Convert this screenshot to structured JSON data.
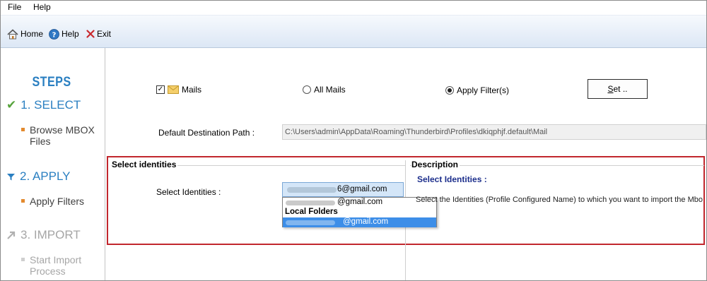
{
  "menu": {
    "file": "File",
    "help": "Help"
  },
  "toolbar": {
    "home": "Home",
    "help": "Help",
    "exit": "Exit"
  },
  "sidebar": {
    "title": "STEPS",
    "steps": [
      {
        "label": "1. SELECT",
        "sub": "Browse MBOX Files"
      },
      {
        "label": "2. APPLY",
        "sub": "Apply Filters"
      },
      {
        "label": "3. IMPORT",
        "sub": "Start Import Process"
      }
    ]
  },
  "main": {
    "mails_label": "Mails",
    "mails_checked": true,
    "all_mails_label": "All Mails",
    "apply_filters_label": "Apply Filter(s)",
    "selected_option": "apply_filters",
    "set_button": {
      "mnemonic": "S",
      "rest": "et .."
    },
    "destination_label": "Default Destination Path :",
    "destination_value": "C:\\Users\\admin\\AppData\\Roaming\\Thunderbird\\Profiles\\dkiqphjf.default\\Mail"
  },
  "identities": {
    "group_title": "Select identities",
    "field_label": "Select Identities :",
    "selected_value": "6@gmail.com",
    "options": [
      "@gmail.com",
      "Local Folders",
      "@gmail.com"
    ],
    "selected_index": 2
  },
  "description": {
    "group_title": "Description",
    "heading": "Select Identities :",
    "text": "Select the Identities (Profile Configured Name) to  which  you want to import the Mbo"
  },
  "colors": {
    "accent": "#2a7fc1",
    "check": "#57a33c",
    "bullet": "#e38a2e",
    "highlight_box": "#c1272d",
    "selection": "#3d8ee8",
    "desc_heading": "#1d2f8c"
  },
  "icons": [
    "home-icon",
    "help-icon",
    "exit-icon",
    "checkmark-icon",
    "filter-icon",
    "arrow-right-icon",
    "mail-envelope-icon"
  ]
}
